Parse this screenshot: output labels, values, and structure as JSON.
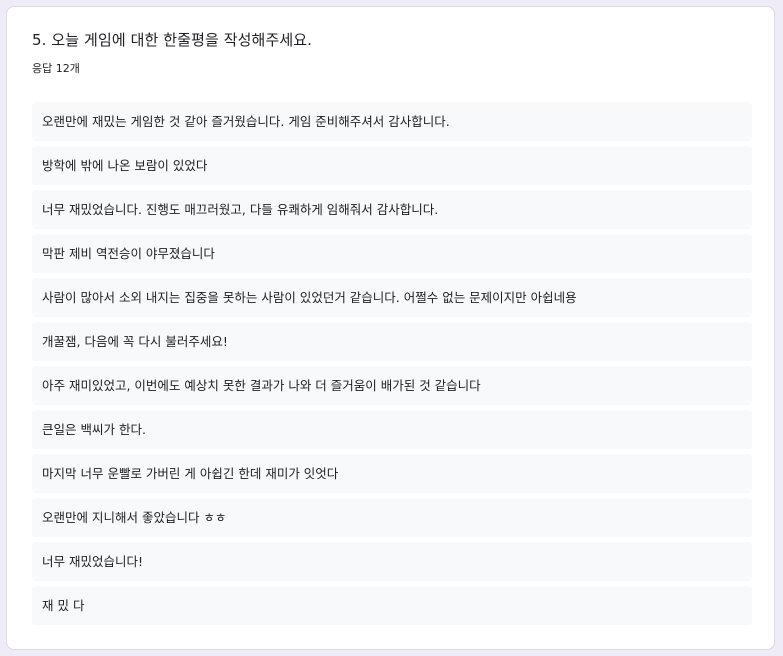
{
  "question": {
    "title": "5.  오늘 게임에 대한 한줄평을 작성해주세요.",
    "response_count": "응답 12개"
  },
  "answers": [
    "오랜만에 재밌는 게임한 것 같아 즐거웠습니다. 게임 준비해주셔서 감사합니다.",
    "방학에 밖에 나온 보람이 있었다",
    "너무 재밌었습니다. 진행도 매끄러웠고, 다들 유쾌하게 임해줘서 감사합니다.",
    "막판 제비 역전승이 야무졌습니다",
    "사람이 많아서 소외 내지는 집중을 못하는 사람이 있었던거 같습니다. 어쩔수 없는 문제이지만 아쉽네용",
    "개꿀잼, 다음에 꼭 다시 불러주세요!",
    "아주 재미있었고, 이번에도 예상치 못한 결과가 나와 더 즐거움이 배가된 것 같습니다",
    "큰일은 백씨가 한다.",
    "마지막 너무 운빨로 가버린 게 아쉽긴 한데 재미가 잇엇다",
    "오랜만에 지니해서 좋았습니다 ㅎㅎ",
    "너무 재밌었습니다!",
    "재 밌 다"
  ]
}
